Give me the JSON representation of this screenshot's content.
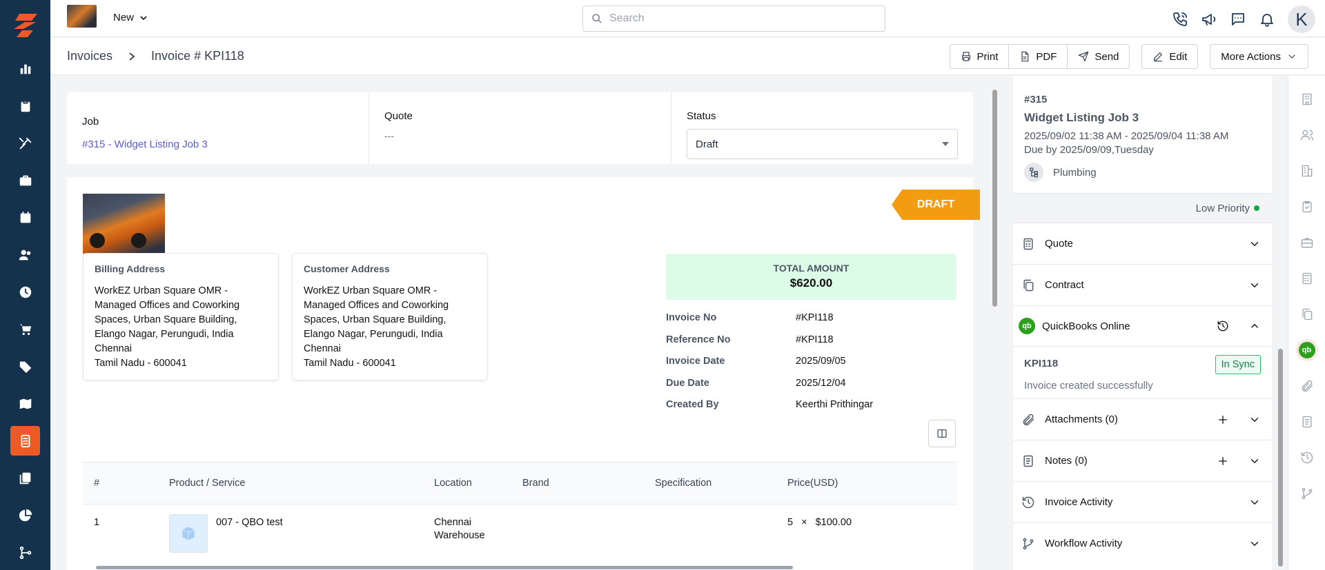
{
  "topbar": {
    "new_label": "New",
    "search_placeholder": "Search",
    "avatar_letter": "K"
  },
  "breadcrumb": {
    "parent": "Invoices",
    "current": "Invoice # KPI118"
  },
  "toolbar": {
    "print": "Print",
    "pdf": "PDF",
    "send": "Send",
    "edit": "Edit",
    "more": "More Actions"
  },
  "summary": {
    "job_label": "Job",
    "job_value": "#315 - Widget Listing Job 3",
    "quote_label": "Quote",
    "quote_value": "---",
    "status_label": "Status",
    "status_value": "Draft"
  },
  "invoice": {
    "badge": "DRAFT",
    "billing": {
      "title": "Billing Address",
      "lines": [
        "WorkEZ Urban Square OMR -",
        "Managed Offices and Coworking",
        "Spaces, Urban Square Building,",
        "Elango Nagar, Perungudi, India",
        "Chennai",
        "Tamil Nadu - 600041"
      ]
    },
    "customer": {
      "title": "Customer Address",
      "lines": [
        "WorkEZ Urban Square OMR -",
        "Managed Offices and Coworking",
        "Spaces, Urban Square Building,",
        "Elango Nagar, Perungudi, India",
        "Chennai",
        "Tamil Nadu - 600041"
      ]
    },
    "total_label": "TOTAL AMOUNT",
    "total_value": "$620.00",
    "meta": [
      {
        "k": "Invoice No",
        "v": "#KPI118"
      },
      {
        "k": "Reference No",
        "v": "#KPI118"
      },
      {
        "k": "Invoice Date",
        "v": "2025/09/05"
      },
      {
        "k": "Due Date",
        "v": "2025/12/04"
      },
      {
        "k": "Created By",
        "v": "Keerthi Prithingar"
      }
    ],
    "table": {
      "headers": [
        "#",
        "Product / Service",
        "Location",
        "Brand",
        "Specification",
        "Price(USD)"
      ],
      "rows": [
        {
          "num": "1",
          "product": "007 - QBO test",
          "location_1": "Chennai",
          "location_2": "Warehouse",
          "qty": "5",
          "times": "×",
          "price": "$100.00"
        }
      ]
    }
  },
  "panel": {
    "job_number": "#315",
    "job_title": "Widget Listing Job 3",
    "job_dates": "2025/09/02 11:38 AM - 2025/09/04 11:38 AM",
    "job_due": "Due by 2025/09/09,Tuesday",
    "category": "Plumbing",
    "priority": "Low Priority",
    "sections": {
      "quote": "Quote",
      "contract": "Contract",
      "quickbooks": "QuickBooks Online",
      "attachments": "Attachments (0)",
      "notes": "Notes (0)",
      "invoice_activity": "Invoice Activity",
      "workflow_activity": "Workflow Activity"
    },
    "qb_icon": "qb",
    "qb_id": "KPI118",
    "qb_status": "In Sync",
    "qb_message": "Invoice created successfully"
  },
  "colors": {
    "sidebar": "#14324c",
    "accent": "#ef5a24",
    "draft": "#f39c12",
    "link": "#5b5bd6",
    "sync": "#22c55e"
  }
}
